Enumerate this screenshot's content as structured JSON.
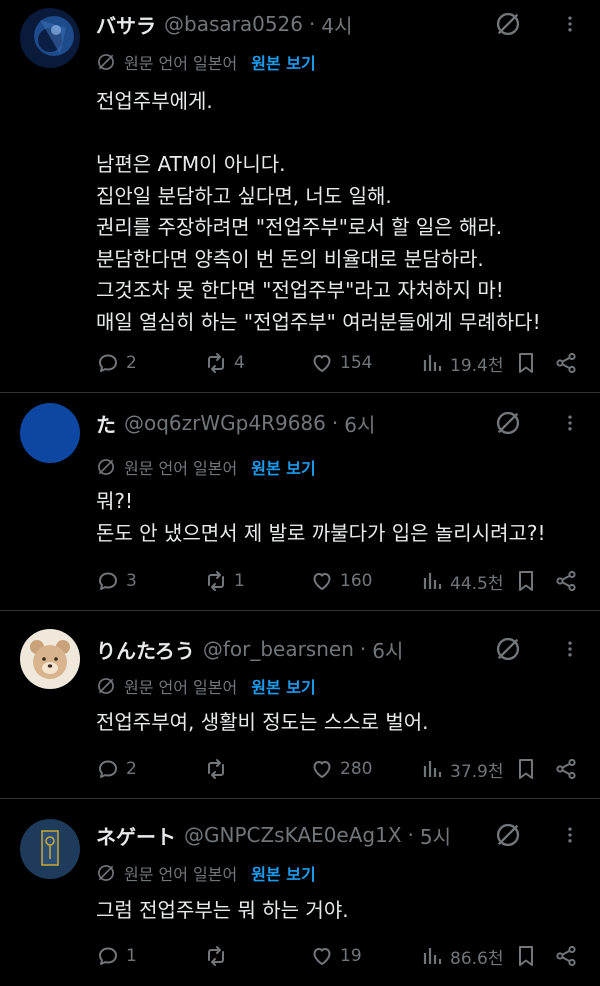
{
  "translate": {
    "label": "원문 언어 일본어",
    "link": "원본 보기"
  },
  "tweets": [
    {
      "name": "バサラ",
      "handle": "@basara0526",
      "time": "4시",
      "lines": [
        "전업주부에게.",
        "",
        "남편은 ATM이 아니다.",
        "집안일 분담하고 싶다면, 너도 일해.",
        "권리를 주장하려면 \"전업주부\"로서 할 일은 해라.",
        "분담한다면 양측이 번 돈의 비율대로 분담하라.",
        "그것조차 못 한다면 \"전업주부\"라고 자처하지 마!",
        "매일 열심히 하는 \"전업주부\" 여러분들에게 무례하다!"
      ],
      "replies": "2",
      "retweets": "4",
      "likes": "154",
      "views": "19.4천"
    },
    {
      "name": "た",
      "handle": "@oq6zrWGp4R9686",
      "time": "6시",
      "lines": [
        "뭐?!",
        "돈도 안 냈으면서 제 발로 까불다가 입은 놀리시려고?!"
      ],
      "replies": "3",
      "retweets": "1",
      "likes": "160",
      "views": "44.5천"
    },
    {
      "name": "りんたろう",
      "handle": "@for_bearsnen",
      "time": "6시",
      "lines": [
        "전업주부여, 생활비 정도는 스스로 벌어."
      ],
      "replies": "2",
      "retweets": "",
      "likes": "280",
      "views": "37.9천"
    },
    {
      "name": "ネゲート",
      "handle": "@GNPCZsKAE0eAg1X",
      "time": "5시",
      "lines": [
        "그럼 전업주부는 뭐 하는 거야."
      ],
      "replies": "1",
      "retweets": "",
      "likes": "19",
      "views": "86.6천"
    }
  ],
  "colors": {
    "background": "#000000",
    "text": "#e7e9ea",
    "muted": "#71767b",
    "link": "#1d9bf0"
  },
  "icons": [
    "mute-icon",
    "more-icon",
    "translate-icon",
    "reply-icon",
    "retweet-icon",
    "like-icon",
    "views-icon",
    "bookmark-icon",
    "share-icon"
  ]
}
